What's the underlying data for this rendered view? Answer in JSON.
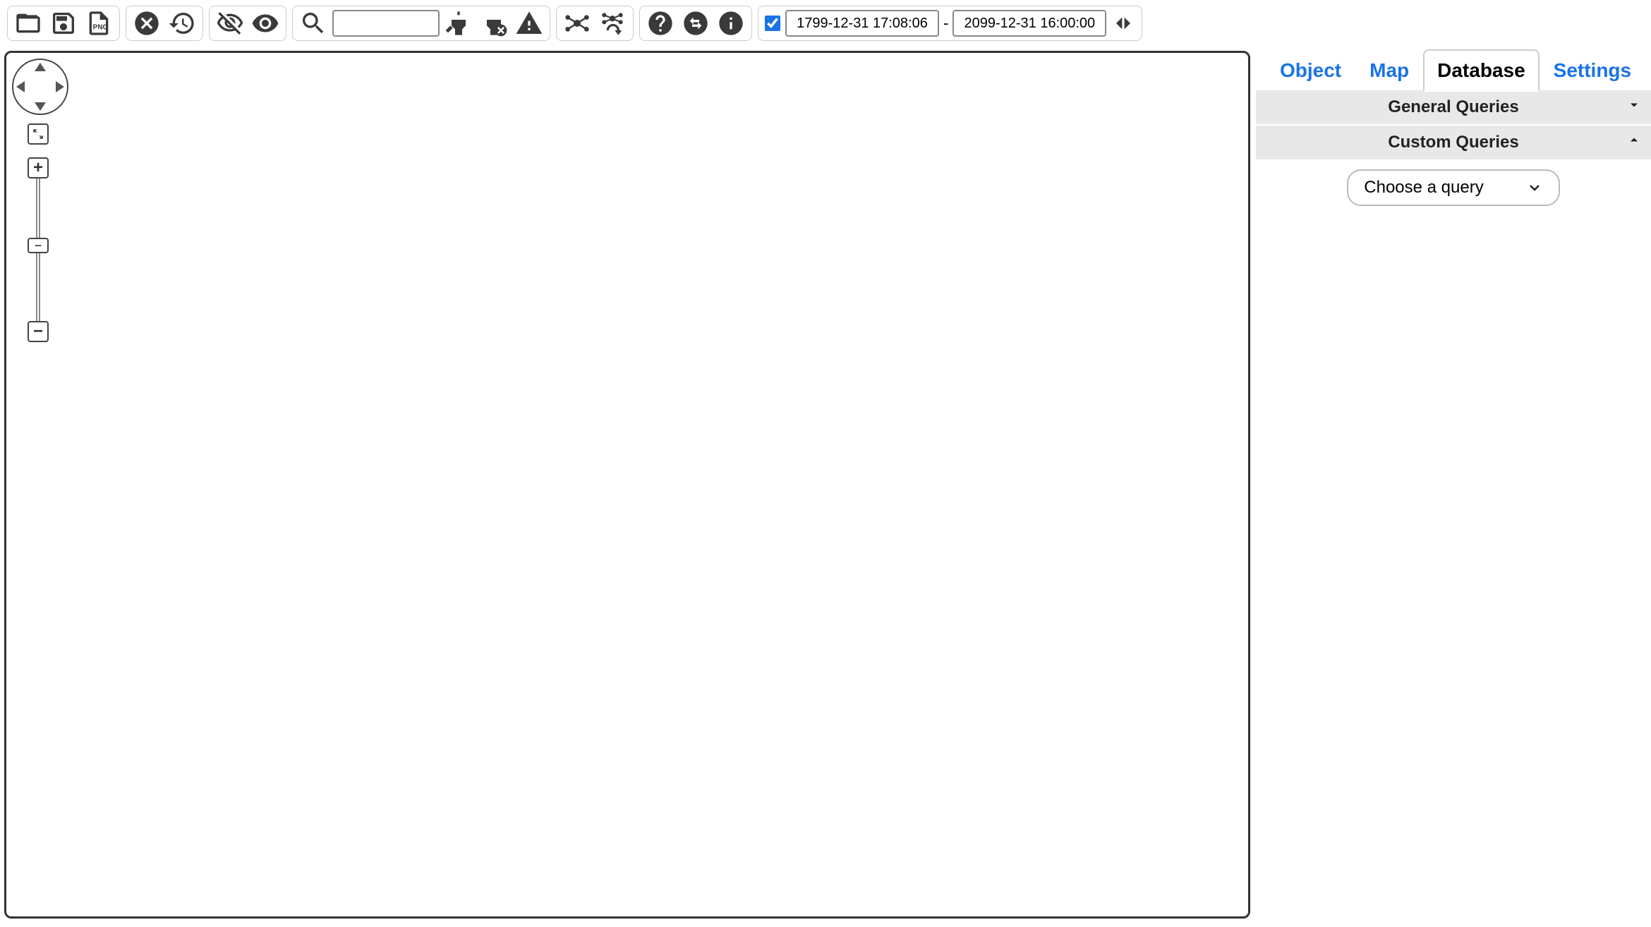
{
  "toolbar": {
    "search_value": "",
    "search_placeholder": "",
    "date_start": "1799-12-31 17:08:06",
    "date_sep": "-",
    "date_end": "2099-12-31 16:00:00"
  },
  "tabs": {
    "object": "Object",
    "map": "Map",
    "database": "Database",
    "settings": "Settings",
    "active": "database"
  },
  "panel": {
    "general_label": "General Queries",
    "custom_label": "Custom Queries",
    "choose_query": "Choose a query"
  },
  "zoom": {
    "plus": "+",
    "minus": "−",
    "handle": "−"
  }
}
